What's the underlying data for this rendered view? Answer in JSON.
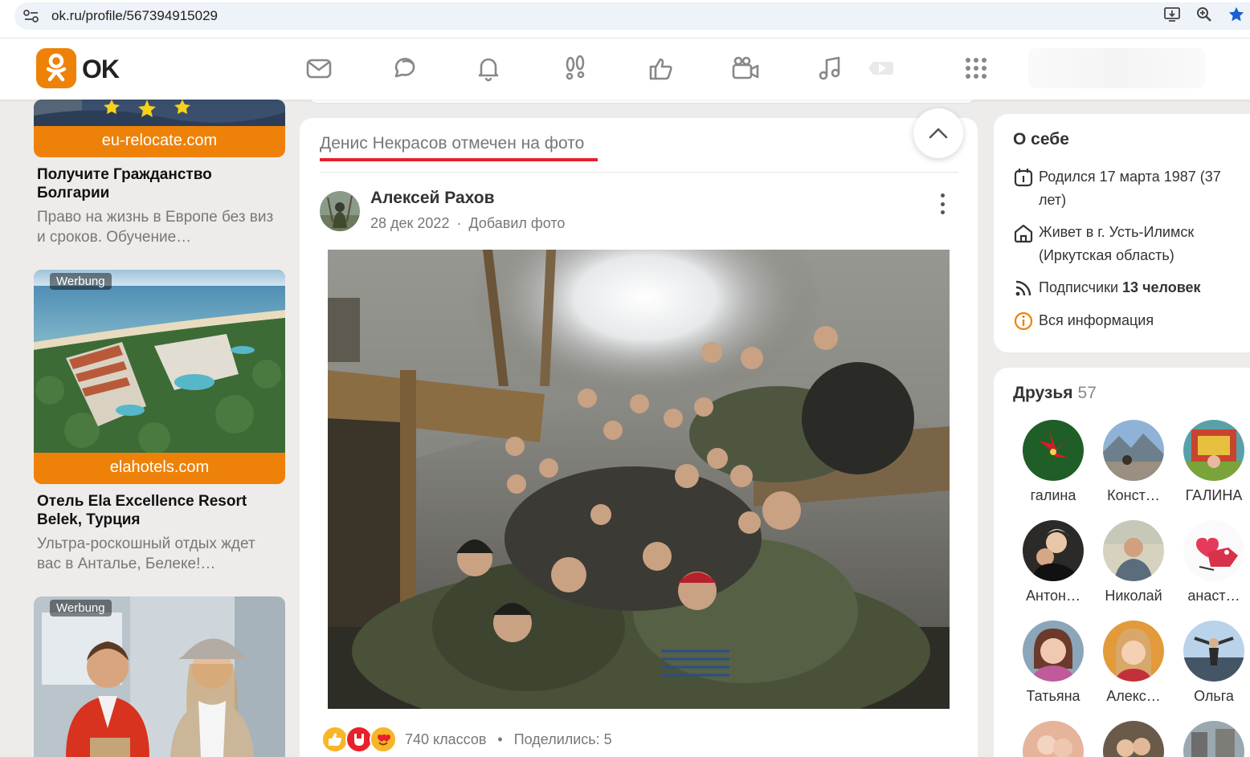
{
  "browser": {
    "url": "ok.ru/profile/567394915029",
    "icons": [
      "site-info-icon",
      "install-app-icon",
      "zoom-icon",
      "bookmark-star-icon"
    ]
  },
  "header": {
    "brand": "OK",
    "logo_color": "#ee8208",
    "nav_icons": [
      "messages-icon",
      "discussions-icon",
      "notifications-icon",
      "guests-icon",
      "events-icon",
      "video-icon",
      "music-icon",
      "video-play-icon",
      "more-apps-icon"
    ]
  },
  "ads": [
    {
      "domain": "eu-relocate.com",
      "title": "Получите Гражданство Болгарии",
      "desc": "Право на жизнь в Европе без виз и сроков. Обучение…"
    },
    {
      "badge": "Werbung",
      "domain": "elahotels.com",
      "title": "Отель Ela Excellence Resort Belek, Турция",
      "desc": "Ультра-роскошный отдых ждет вас в Анталье, Белеке!…"
    },
    {
      "badge": "Werbung"
    }
  ],
  "feed": {
    "tag_title": "Денис Некрасов отмечен на фото",
    "accent_color": "#e8202a",
    "author": "Алексей Рахов",
    "date": "28 дек 2022",
    "meta_sep": "·",
    "action": "Добавил фото",
    "reactions": [
      "like-reaction-icon",
      "rock-reaction-icon",
      "love-reaction-icon"
    ],
    "klass_count": "740 классов",
    "dot": "•",
    "shared": "Поделились: 5"
  },
  "about": {
    "title": "О себе",
    "born": "Родился 17 марта 1987 (37 лет)",
    "lives": "Живет в г. Усть-Илимск (Иркутская область)",
    "followers_prefix": "Подписчики",
    "followers_value": "13 человек",
    "all_info": "Вся информация"
  },
  "friends": {
    "title": "Друзья",
    "count": "57",
    "list": [
      {
        "name": "галина"
      },
      {
        "name": "Конст…"
      },
      {
        "name": "ГАЛИНА"
      },
      {
        "name": "Антон…"
      },
      {
        "name": "Николай"
      },
      {
        "name": "анаст…"
      },
      {
        "name": "Татьяна"
      },
      {
        "name": "Алекс…"
      },
      {
        "name": "Ольга"
      }
    ]
  }
}
